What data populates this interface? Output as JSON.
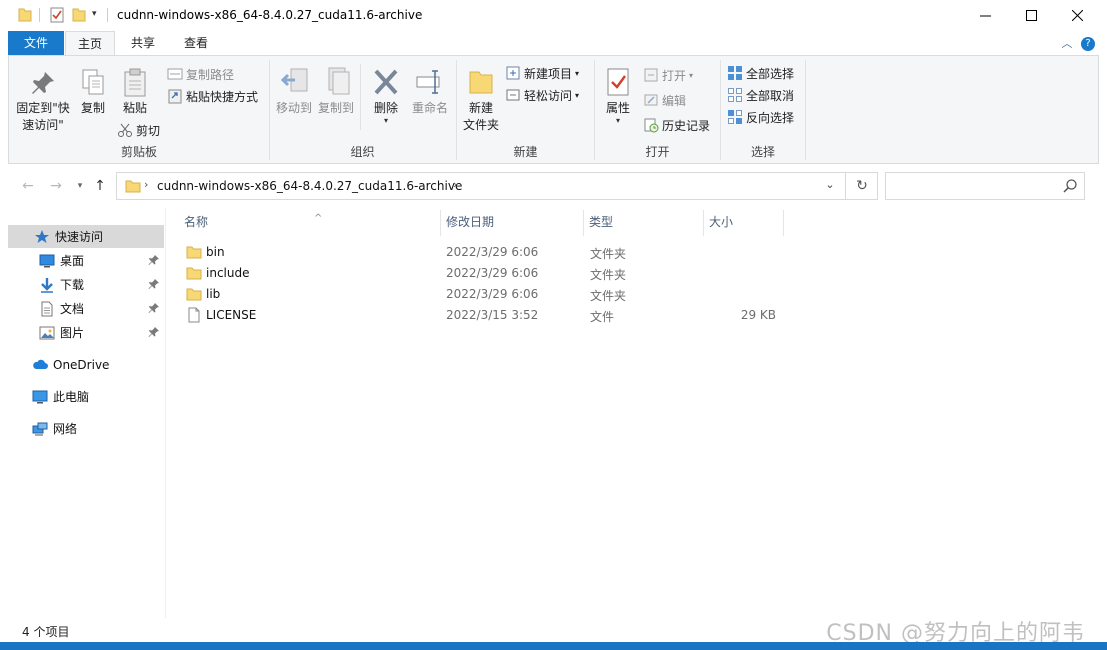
{
  "window": {
    "title": "cudnn-windows-x86_64-8.4.0.27_cuda11.6-archive"
  },
  "tabs": [
    {
      "label": "文件"
    },
    {
      "label": "主页"
    },
    {
      "label": "共享"
    },
    {
      "label": "查看"
    }
  ],
  "ribbon": {
    "clipboard": {
      "label": "剪贴板",
      "pin_quick_access": "固定到\"快\n速访问\"",
      "copy": "复制",
      "paste": "粘贴",
      "copy_path": "复制路径",
      "paste_shortcut": "粘贴快捷方式",
      "cut": "剪切"
    },
    "organize": {
      "label": "组织",
      "move_to": "移动到",
      "copy_to": "复制到",
      "delete": "删除",
      "rename": "重命名"
    },
    "new": {
      "label": "新建",
      "new_folder": "新建\n文件夹",
      "new_item": "新建项目",
      "easy_access": "轻松访问"
    },
    "open": {
      "label": "打开",
      "properties": "属性",
      "open": "打开",
      "edit": "编辑",
      "history": "历史记录"
    },
    "select": {
      "label": "选择",
      "select_all": "全部选择",
      "select_none": "全部取消",
      "invert": "反向选择"
    }
  },
  "address": {
    "path": "cudnn-windows-x86_64-8.4.0.27_cuda11.6-archive"
  },
  "search": {
    "placeholder": ""
  },
  "sidebar": {
    "quick_access": "快速访问",
    "items": [
      {
        "label": "桌面"
      },
      {
        "label": "下载"
      },
      {
        "label": "文档"
      },
      {
        "label": "图片"
      }
    ],
    "onedrive": "OneDrive",
    "this_pc": "此电脑",
    "network": "网络"
  },
  "columns": {
    "name": "名称",
    "date": "修改日期",
    "type": "类型",
    "size": "大小"
  },
  "files": [
    {
      "name": "bin",
      "date": "2022/3/29 6:06",
      "type": "文件夹",
      "size": "",
      "kind": "folder"
    },
    {
      "name": "include",
      "date": "2022/3/29 6:06",
      "type": "文件夹",
      "size": "",
      "kind": "folder"
    },
    {
      "name": "lib",
      "date": "2022/3/29 6:06",
      "type": "文件夹",
      "size": "",
      "kind": "folder"
    },
    {
      "name": "LICENSE",
      "date": "2022/3/15 3:52",
      "type": "文件",
      "size": "29 KB",
      "kind": "file"
    }
  ],
  "status": {
    "count": "4 个项目"
  },
  "watermark": "CSDN @努力向上的阿韦",
  "colors": {
    "accent": "#1979ca",
    "folder": "#f8d775",
    "selected": "#d9d9d9"
  }
}
